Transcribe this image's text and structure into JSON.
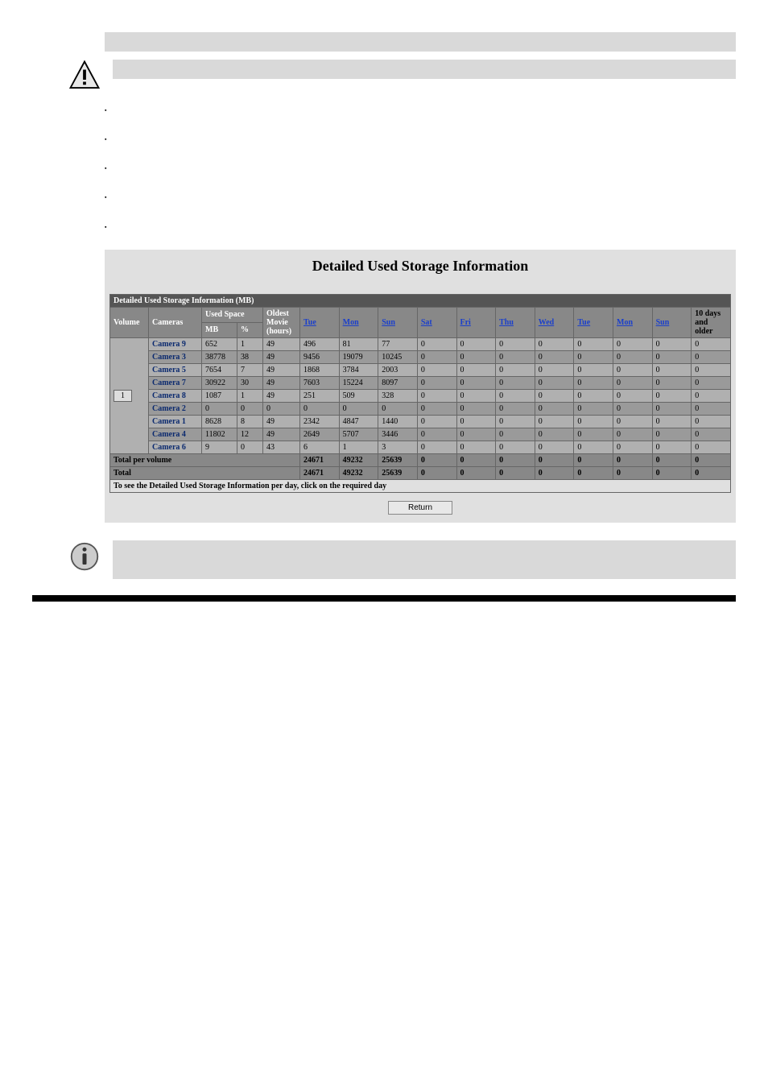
{
  "section_heading": "",
  "intro_para1": "",
  "intro_para2": "",
  "warning_heading": "",
  "warning_text": "",
  "detailed_lead": "",
  "bullets": [
    "",
    "",
    "",
    "",
    ""
  ],
  "screenshot": {
    "title": "Detailed Used Storage Information",
    "table_caption": "Detailed Used Storage Information (MB)",
    "headers": {
      "volume": "Volume",
      "cameras": "Cameras",
      "used_space": "Used Space",
      "mb": "MB",
      "pct": "%",
      "oldest": "Oldest Movie (hours)",
      "last_col": "10 days and older"
    },
    "day_cols": [
      "Tue",
      "Mon",
      "Sun",
      "Sat",
      "Fri",
      "Thu",
      "Wed",
      "Tue",
      "Mon",
      "Sun"
    ],
    "volume": "1",
    "rows": [
      {
        "cam": "Camera 9",
        "mb": "652",
        "pct": "1",
        "oldest": "49",
        "vals": [
          "496",
          "81",
          "77",
          "0",
          "0",
          "0",
          "0",
          "0",
          "0",
          "0",
          "0"
        ]
      },
      {
        "cam": "Camera 3",
        "mb": "38778",
        "pct": "38",
        "oldest": "49",
        "vals": [
          "9456",
          "19079",
          "10245",
          "0",
          "0",
          "0",
          "0",
          "0",
          "0",
          "0",
          "0"
        ]
      },
      {
        "cam": "Camera 5",
        "mb": "7654",
        "pct": "7",
        "oldest": "49",
        "vals": [
          "1868",
          "3784",
          "2003",
          "0",
          "0",
          "0",
          "0",
          "0",
          "0",
          "0",
          "0"
        ]
      },
      {
        "cam": "Camera 7",
        "mb": "30922",
        "pct": "30",
        "oldest": "49",
        "vals": [
          "7603",
          "15224",
          "8097",
          "0",
          "0",
          "0",
          "0",
          "0",
          "0",
          "0",
          "0"
        ]
      },
      {
        "cam": "Camera 8",
        "mb": "1087",
        "pct": "1",
        "oldest": "49",
        "vals": [
          "251",
          "509",
          "328",
          "0",
          "0",
          "0",
          "0",
          "0",
          "0",
          "0",
          "0"
        ]
      },
      {
        "cam": "Camera 2",
        "mb": "0",
        "pct": "0",
        "oldest": "0",
        "vals": [
          "0",
          "0",
          "0",
          "0",
          "0",
          "0",
          "0",
          "0",
          "0",
          "0",
          "0"
        ]
      },
      {
        "cam": "Camera 1",
        "mb": "8628",
        "pct": "8",
        "oldest": "49",
        "vals": [
          "2342",
          "4847",
          "1440",
          "0",
          "0",
          "0",
          "0",
          "0",
          "0",
          "0",
          "0"
        ]
      },
      {
        "cam": "Camera 4",
        "mb": "11802",
        "pct": "12",
        "oldest": "49",
        "vals": [
          "2649",
          "5707",
          "3446",
          "0",
          "0",
          "0",
          "0",
          "0",
          "0",
          "0",
          "0"
        ]
      },
      {
        "cam": "Camera 6",
        "mb": "9",
        "pct": "0",
        "oldest": "43",
        "vals": [
          "6",
          "1",
          "3",
          "0",
          "0",
          "0",
          "0",
          "0",
          "0",
          "0",
          "0"
        ]
      }
    ],
    "total_per_volume_label": "Total per volume",
    "total_per_volume_vals": [
      "24671",
      "49232",
      "25639",
      "0",
      "0",
      "0",
      "0",
      "0",
      "0",
      "0",
      "0"
    ],
    "total_label": "Total",
    "total_vals": [
      "24671",
      "49232",
      "25639",
      "0",
      "0",
      "0",
      "0",
      "0",
      "0",
      "0",
      "0"
    ],
    "footnote": "To see the Detailed Used Storage Information per day, click on the required day",
    "return_label": "Return"
  },
  "info_text": "",
  "footer_left": "",
  "footer_right": ""
}
